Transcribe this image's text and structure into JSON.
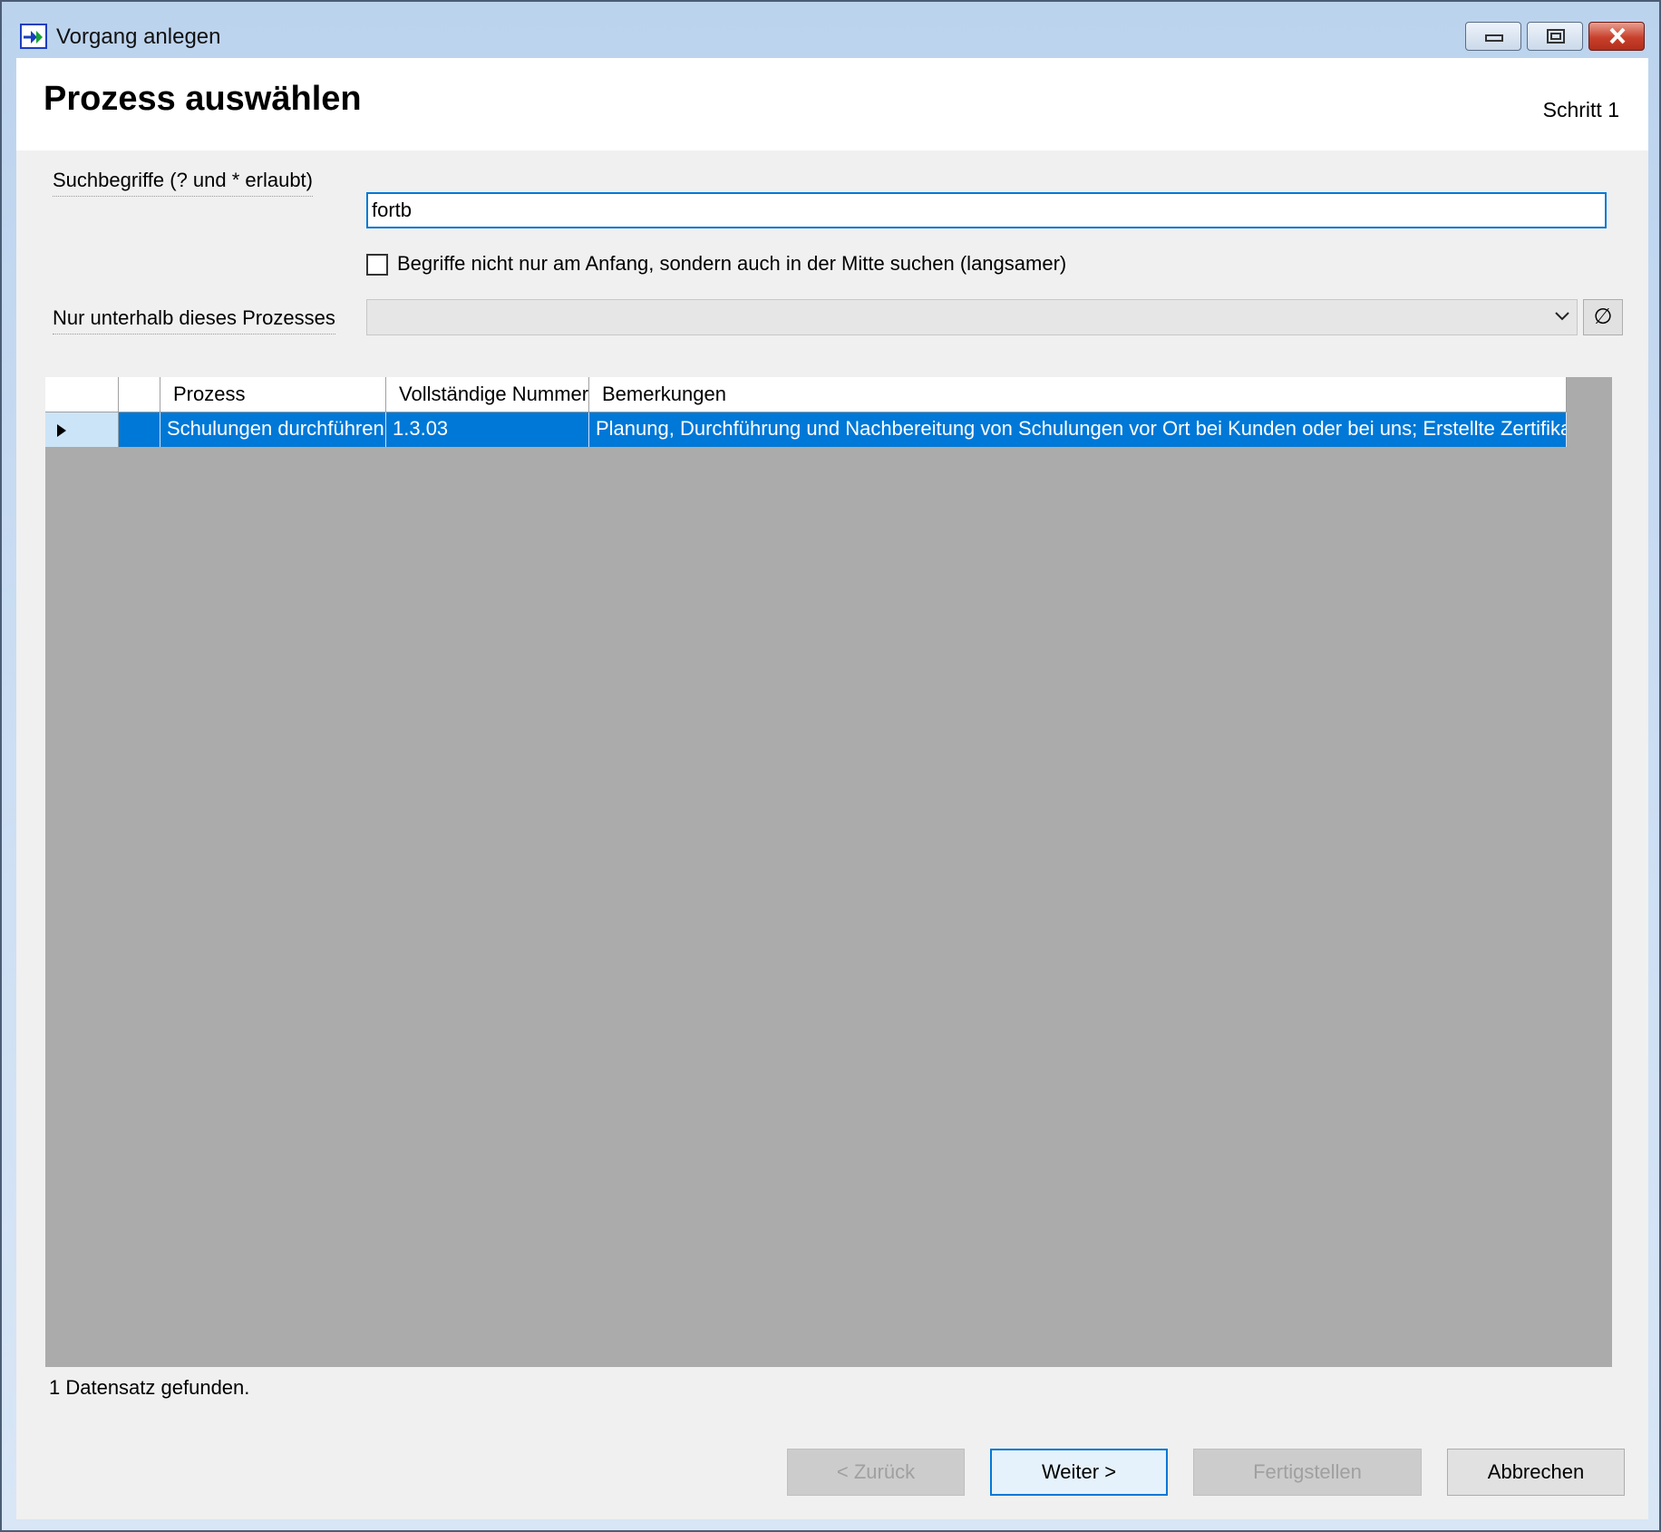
{
  "window": {
    "title": "Vorgang anlegen",
    "icons": {
      "app": "forward-arrows-icon",
      "minimize": "minimize-icon",
      "maximize": "maximize-icon",
      "close": "close-icon"
    }
  },
  "header": {
    "title": "Prozess auswählen",
    "step": "Schritt 1"
  },
  "search": {
    "label": "Suchbegriffe (? und * erlaubt)",
    "value": "fortb",
    "checkbox_label": "Begriffe nicht nur am Anfang, sondern auch in der Mitte suchen (langsamer)",
    "checkbox_checked": false
  },
  "filter": {
    "label": "Nur unterhalb dieses Prozesses",
    "value": "",
    "clear_symbol": "∅"
  },
  "grid": {
    "columns": [
      "",
      "",
      "Prozess",
      "Vollständige Nummer",
      "Bemerkungen"
    ],
    "rows": [
      {
        "prozess": "Schulungen durchführen",
        "nummer": "1.3.03",
        "bemerkungen": "Planung, Durchführung und Nachbereitung von Schulungen vor Ort bei Kunden oder bei uns; Erstellte Zertifikate",
        "selected": true
      }
    ]
  },
  "status": "1 Datensatz gefunden.",
  "buttons": {
    "back": "< Zurück",
    "next": "Weiter >",
    "finish": "Fertigstellen",
    "cancel": "Abbrechen"
  },
  "colors": {
    "selection": "#0078d7",
    "grid_background": "#ababab",
    "dialog_background": "#f0f0f0"
  }
}
